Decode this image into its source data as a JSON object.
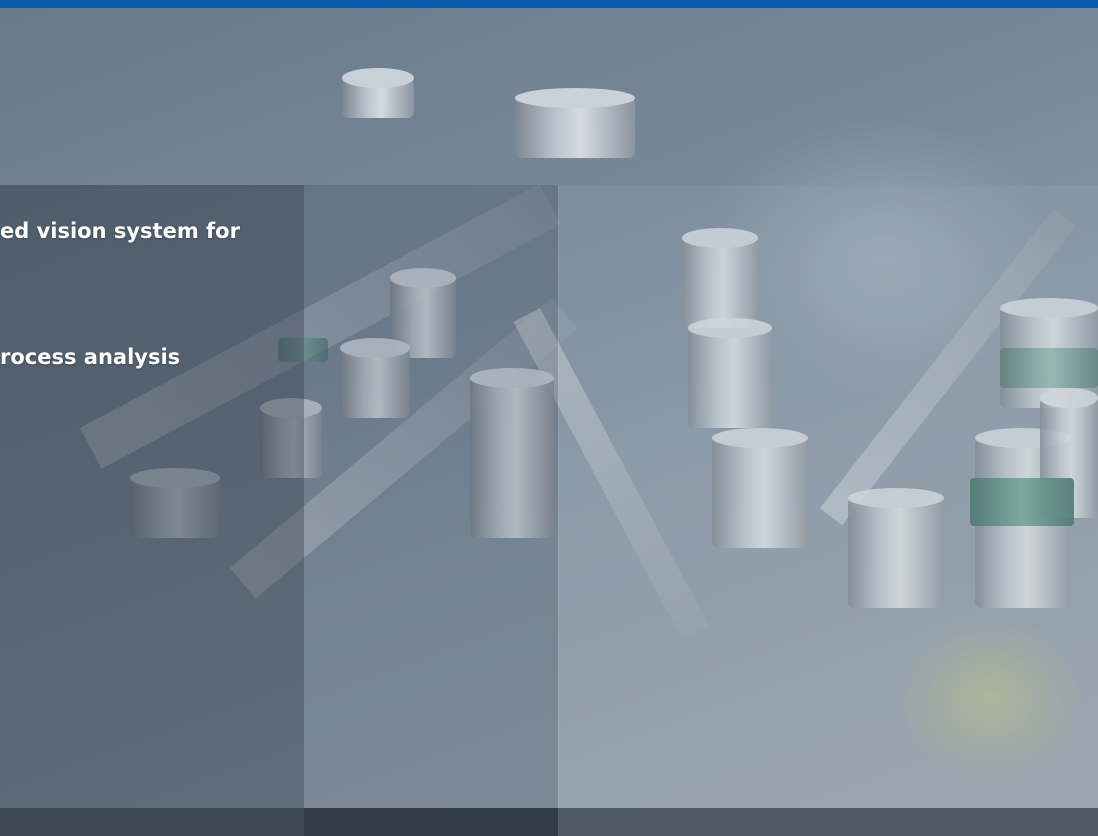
{
  "hero": {
    "headline_line1": "ed vision system for",
    "headline_line2": "rocess analysis"
  },
  "colors": {
    "top_bar": "#0a5cb0",
    "text": "#ffffff"
  }
}
